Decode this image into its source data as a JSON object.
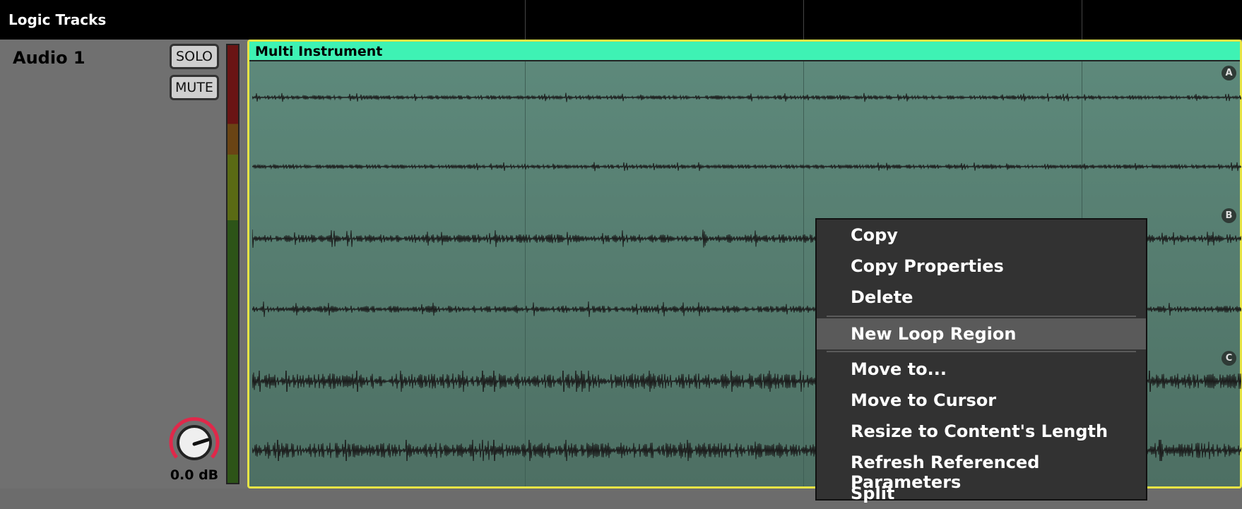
{
  "app": {
    "panel_title": "Logic Tracks"
  },
  "track": {
    "name": "Audio 1",
    "solo_label": "SOLO",
    "mute_label": "MUTE",
    "gain_label": "0.0 dB",
    "knob_color": "#e0284a"
  },
  "region": {
    "title": "Multi Instrument",
    "title_color": "#3ef2b4",
    "border_color": "#e7e445",
    "channel_labels": [
      "A",
      "B",
      "C"
    ]
  },
  "context_menu": {
    "items": [
      {
        "label": "Copy"
      },
      {
        "label": "Copy Properties"
      },
      {
        "label": "Delete"
      },
      {
        "label": "New Loop Region",
        "highlighted": true
      },
      {
        "label": "Move to..."
      },
      {
        "label": "Move to Cursor"
      },
      {
        "label": "Resize to Content's Length"
      },
      {
        "label": "Refresh Referenced Parameters"
      },
      {
        "label": "Split"
      }
    ]
  }
}
